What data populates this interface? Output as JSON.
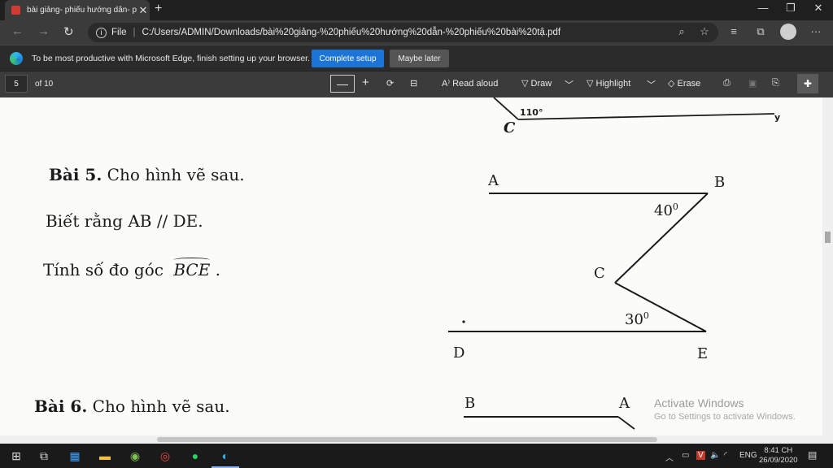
{
  "browser": {
    "tab_title": "bài giảng- phiếu hướng dẫn- ph",
    "tab_close": "✕",
    "new_tab": "+",
    "url_label": "File",
    "url": "C:/Users/ADMIN/Downloads/bài%20giảng-%20phiếu%20hướng%20dẫn-%20phiếu%20bài%20tậ.pdf",
    "window": {
      "minimize": "—",
      "restore": "❐",
      "close": "✕"
    },
    "more": "···"
  },
  "infobar": {
    "message": "To be most productive with Microsoft Edge, finish setting up your browser.",
    "primary_button": "Complete setup",
    "secondary_button": "Maybe later"
  },
  "pdf_toolbar": {
    "page_number": "5",
    "page_total": "of 10",
    "zoom_out": "—",
    "zoom_in": "+",
    "read_aloud": "Read aloud",
    "draw": "Draw",
    "highlight": "Highlight",
    "erase": "Erase"
  },
  "document": {
    "top_fig": {
      "angle": "110°",
      "point_c": "C",
      "point_y": "y"
    },
    "bai5_title": "Bài 5.",
    "bai5_text": " Cho hình vẽ sau.",
    "bai5_given": "Biết rằng AB // DE.",
    "bai5_question": "Tính số đo góc",
    "bai5_angle": "BCE",
    "bai5_period": ".",
    "fig5": {
      "A": "A",
      "B": "B",
      "C": "C",
      "D": "D",
      "E": "E",
      "angle_b": "40",
      "angle_e": "30",
      "deg": "0"
    },
    "bai6_title": "Bài 6.",
    "bai6_text": " Cho hình vẽ sau.",
    "fig6": {
      "B": "B",
      "A": "A"
    }
  },
  "watermark": {
    "line1": "Activate Windows",
    "line2": "Go to Settings to activate Windows."
  },
  "taskbar": {
    "lang": "ENG",
    "time": "8:41 CH",
    "date": "26/09/2020"
  },
  "colors": {
    "accent": "#1b74d6",
    "pdf_icon": "#d43b2f"
  }
}
